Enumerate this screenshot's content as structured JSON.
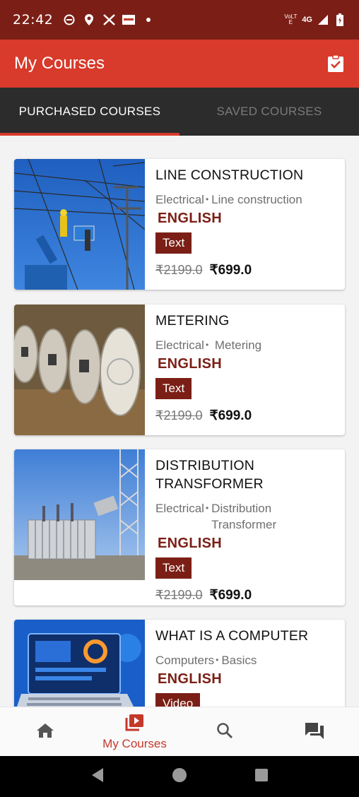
{
  "status_bar": {
    "time": "22:42",
    "left_icons": [
      "app-notification-icon",
      "location-icon",
      "x-icon",
      "image-icon",
      "dot-icon"
    ],
    "volte_label": "VoLTE",
    "network_label": "4G",
    "right_icons": [
      "signal-icon",
      "battery-icon"
    ]
  },
  "app_bar": {
    "title": "My Courses",
    "action_icon": "clipboard-check-icon"
  },
  "tabs": [
    {
      "label": "PURCHASED COURSES",
      "active": true
    },
    {
      "label": "SAVED COURSES",
      "active": false
    }
  ],
  "courses": [
    {
      "title": "LINE CONSTRUCTION",
      "category": "Electrical",
      "subcategory": "Line construction",
      "language": "ENGLISH",
      "format": "Text",
      "original_price": "₹2199.0",
      "price": "₹699.0",
      "image": "line-construction-photo"
    },
    {
      "title": "METERING",
      "category": "Electrical",
      "subcategory": " Metering",
      "language": "ENGLISH",
      "format": "Text",
      "original_price": "₹2199.0",
      "price": "₹699.0",
      "image": "electric-meters-photo"
    },
    {
      "title": "DISTRIBUTION TRANSFORMER",
      "category": "Electrical",
      "subcategory": "Distribution Transformer",
      "language": "ENGLISH",
      "format": "Text",
      "original_price": "₹2199.0",
      "price": "₹699.0",
      "image": "transformer-substation-photo"
    },
    {
      "title": "WHAT IS A COMPUTER",
      "category": "Computers",
      "subcategory": "Basics",
      "language": "ENGLISH",
      "format": "Video",
      "image": "laptop-illustration"
    }
  ],
  "bottom_nav": [
    {
      "icon": "home-icon",
      "label": "",
      "active": false
    },
    {
      "icon": "video-library-icon",
      "label": "My Courses",
      "active": true
    },
    {
      "icon": "search-icon",
      "label": "",
      "active": false
    },
    {
      "icon": "forum-icon",
      "label": "",
      "active": false
    }
  ],
  "system_nav": [
    "back-icon",
    "home-circle-icon",
    "recents-icon"
  ],
  "colors": {
    "status_bar": "#7b1f16",
    "app_bar": "#d83a2b",
    "tab_bar": "#2c2c2c",
    "accent": "#7b1f16",
    "active_nav": "#c4382a"
  }
}
